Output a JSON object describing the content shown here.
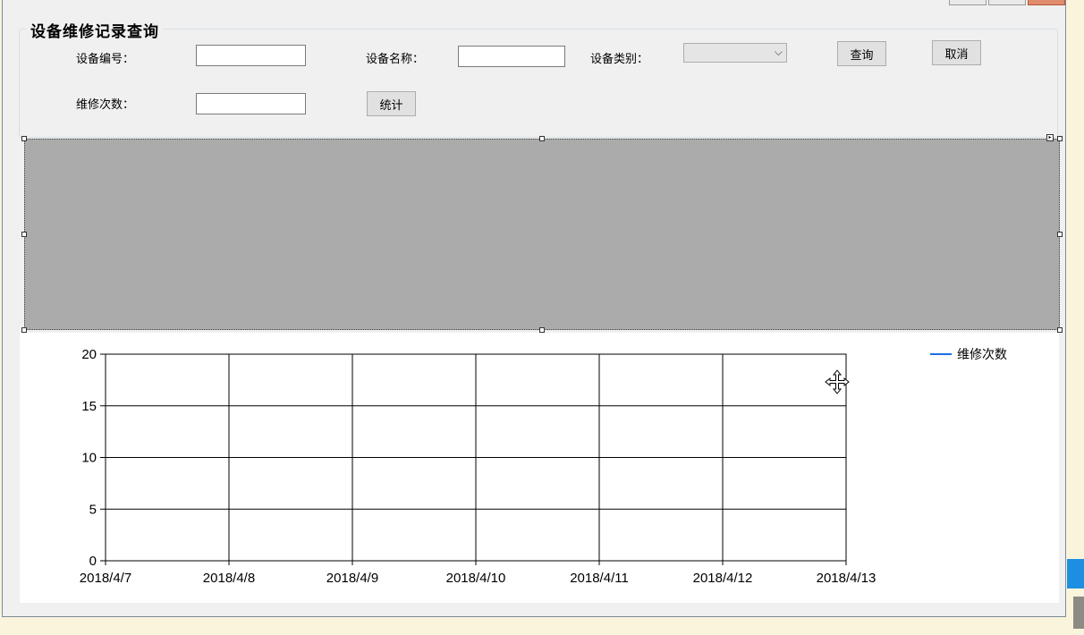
{
  "form": {
    "group_title": "设备维修记录查询",
    "labels": {
      "device_no": "设备编号：",
      "device_name": "设备名称：",
      "device_type": "设备类别：",
      "repair_count": "维修次数："
    },
    "inputs": {
      "device_no": "",
      "device_name": "",
      "device_type_selected": "",
      "repair_count": ""
    },
    "buttons": {
      "query": "查询",
      "cancel": "取消",
      "stats": "统计"
    }
  },
  "icons": {
    "dropdown": "chevron-down-icon",
    "move": "move-cursor-icon"
  },
  "colors": {
    "series_line": "#1e6ee8",
    "grid_placeholder": "#ababab"
  },
  "chart_data": {
    "type": "line",
    "categories": [
      "2018/4/7",
      "2018/4/8",
      "2018/4/9",
      "2018/4/10",
      "2018/4/11",
      "2018/4/12",
      "2018/4/13"
    ],
    "series": [
      {
        "name": "维修次数",
        "values": []
      }
    ],
    "yticks": [
      0,
      5,
      10,
      15,
      20
    ],
    "ylim": [
      0,
      20
    ],
    "grid": true,
    "legend": "top-right"
  }
}
